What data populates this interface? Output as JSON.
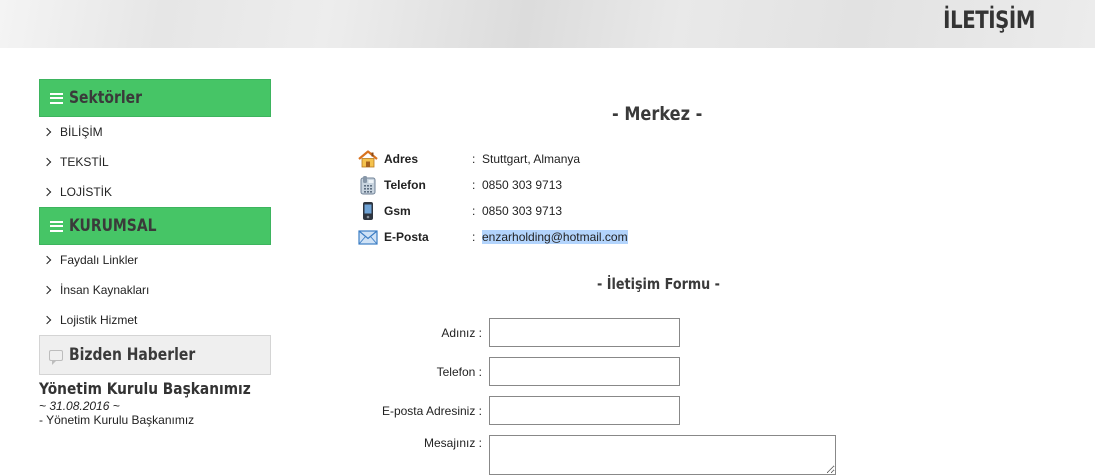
{
  "banner": {
    "title": "İLETİŞİM"
  },
  "sidebar": {
    "sectors": {
      "title": "Sektörler",
      "items": [
        "BİLİŞİM",
        "TEKSTİL",
        "LOJİSTİK"
      ]
    },
    "corporate": {
      "title": "KURUMSAL",
      "items": [
        "Faydalı Linkler",
        "İnsan Kaynakları",
        "Lojistik Hizmet"
      ]
    },
    "news": {
      "title": "Bizden Haberler",
      "item_title": "Yönetim Kurulu Başkanımız",
      "item_date": "~ 31.08.2016 ~",
      "item_desc": "- Yönetim Kurulu Başkanımız"
    }
  },
  "contact": {
    "title": "- Merkez -",
    "separator": ":",
    "rows": [
      {
        "label": "Adres",
        "value": "Stuttgart, Almanya",
        "icon": "home-icon"
      },
      {
        "label": "Telefon",
        "value": "0850 303 9713",
        "icon": "phone-icon"
      },
      {
        "label": "Gsm",
        "value": "0850 303 9713",
        "icon": "mobile-icon"
      },
      {
        "label": "E-Posta",
        "value": "enzarholding@hotmail.com",
        "icon": "mail-icon"
      }
    ]
  },
  "form": {
    "title": "- İletişim Formu -",
    "name_label": "Adınız :",
    "phone_label": "Telefon :",
    "email_label": "E-posta Adresiniz :",
    "message_label": "Mesajınız :",
    "name_value": "",
    "phone_value": "",
    "email_value": "",
    "message_value": ""
  },
  "colors": {
    "accent_green": "#46c566",
    "gray_header": "#efefef",
    "selection": "#b3d4fc"
  }
}
